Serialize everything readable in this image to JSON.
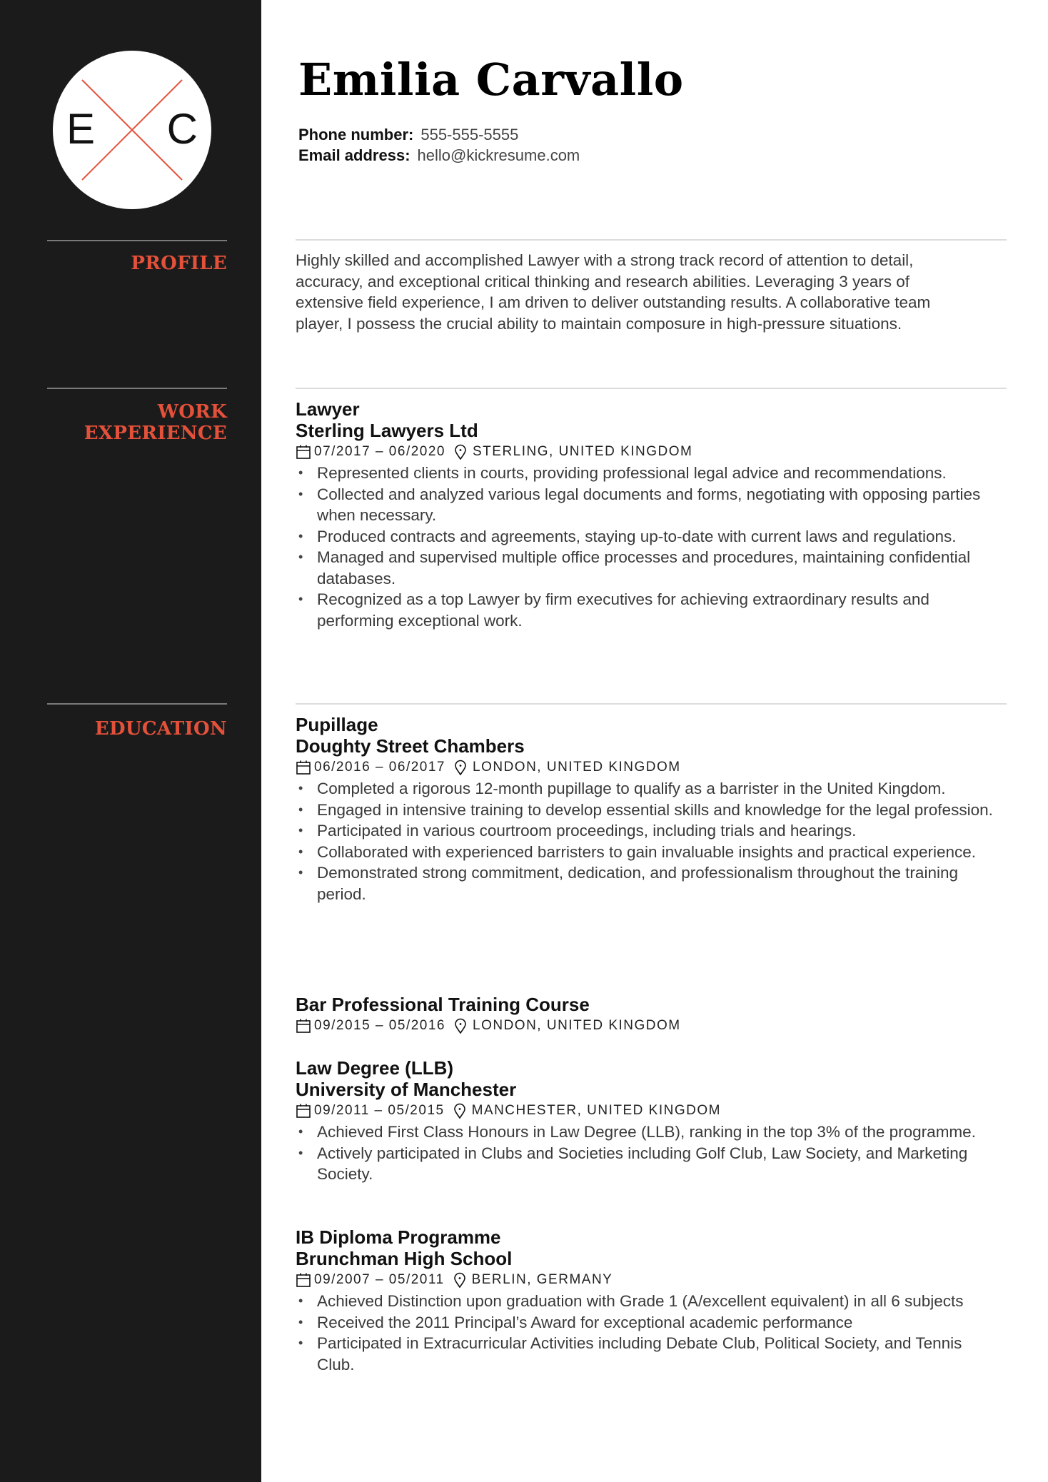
{
  "monogram": {
    "left_letter": "E",
    "right_letter": "C",
    "accent": "#e4513a"
  },
  "header": {
    "name": "Emilia Carvallo",
    "phone_label": "Phone number:",
    "phone": "555-555-5555",
    "email_label": "Email address:",
    "email": "hello@kickresume.com"
  },
  "colors": {
    "sidebar_bg": "#1b1b1b",
    "accent": "#e4513a"
  },
  "sections": {
    "profile": {
      "heading": "PROFILE",
      "text": "Highly skilled and accomplished Lawyer with a strong track record of attention to detail, accuracy, and exceptional critical thinking and research abilities. Leveraging 3 years of extensive field experience, I am driven to deliver outstanding results. A collaborative team player, I possess the crucial ability to maintain composure in high-pressure situations."
    },
    "work": {
      "heading_line1": "WORK",
      "heading_line2": "EXPERIENCE",
      "entries": [
        {
          "title": "Lawyer",
          "org": "Sterling Lawyers Ltd",
          "dates": "07/2017 – 06/2020",
          "location": "STERLING, UNITED KINGDOM",
          "bullets": [
            "Represented clients in courts, providing professional legal advice and recommendations.",
            "Collected and analyzed various legal documents and forms, negotiating with opposing parties when necessary.",
            "Produced contracts and agreements, staying up-to-date with current laws and regulations.",
            "Managed and supervised multiple office processes and procedures, maintaining confidential databases.",
            "Recognized as a top Lawyer by firm executives for achieving extraordinary results and performing exceptional work."
          ]
        }
      ]
    },
    "education": {
      "heading": "EDUCATION",
      "entries": [
        {
          "title": "Pupillage",
          "org": "Doughty Street Chambers",
          "dates": "06/2016 – 06/2017",
          "location": "LONDON, UNITED KINGDOM",
          "bullets": [
            "Completed a rigorous 12-month pupillage to qualify as a barrister in the United Kingdom.",
            "Engaged in intensive training to develop essential skills and knowledge for the legal profession.",
            "Participated in various courtroom proceedings, including trials and hearings.",
            "Collaborated with experienced barristers to gain invaluable insights and practical experience.",
            "Demonstrated strong commitment, dedication, and professionalism throughout the training period."
          ]
        },
        {
          "title": "Bar Professional Training Course",
          "dates": "09/2015 – 05/2016",
          "location": "LONDON, UNITED KINGDOM"
        },
        {
          "title": "Law Degree (LLB)",
          "org": "University of Manchester",
          "dates": "09/2011 – 05/2015",
          "location": "MANCHESTER, UNITED KINGDOM",
          "bullets": [
            "Achieved First Class Honours in Law Degree (LLB), ranking in the top 3% of the programme.",
            "Actively participated in Clubs and Societies including Golf Club, Law Society, and Marketing Society."
          ]
        },
        {
          "title": "IB Diploma Programme",
          "org": "Brunchman High School",
          "dates": "09/2007 – 05/2011",
          "location": "BERLIN, GERMANY",
          "bullets": [
            "Achieved Distinction upon graduation with Grade 1 (A/excellent equivalent) in all 6 subjects",
            "Received the 2011 Principal’s Award for exceptional academic performance",
            "Participated in Extracurricular Activities including Debate Club, Political Society, and Tennis Club."
          ]
        }
      ]
    }
  }
}
